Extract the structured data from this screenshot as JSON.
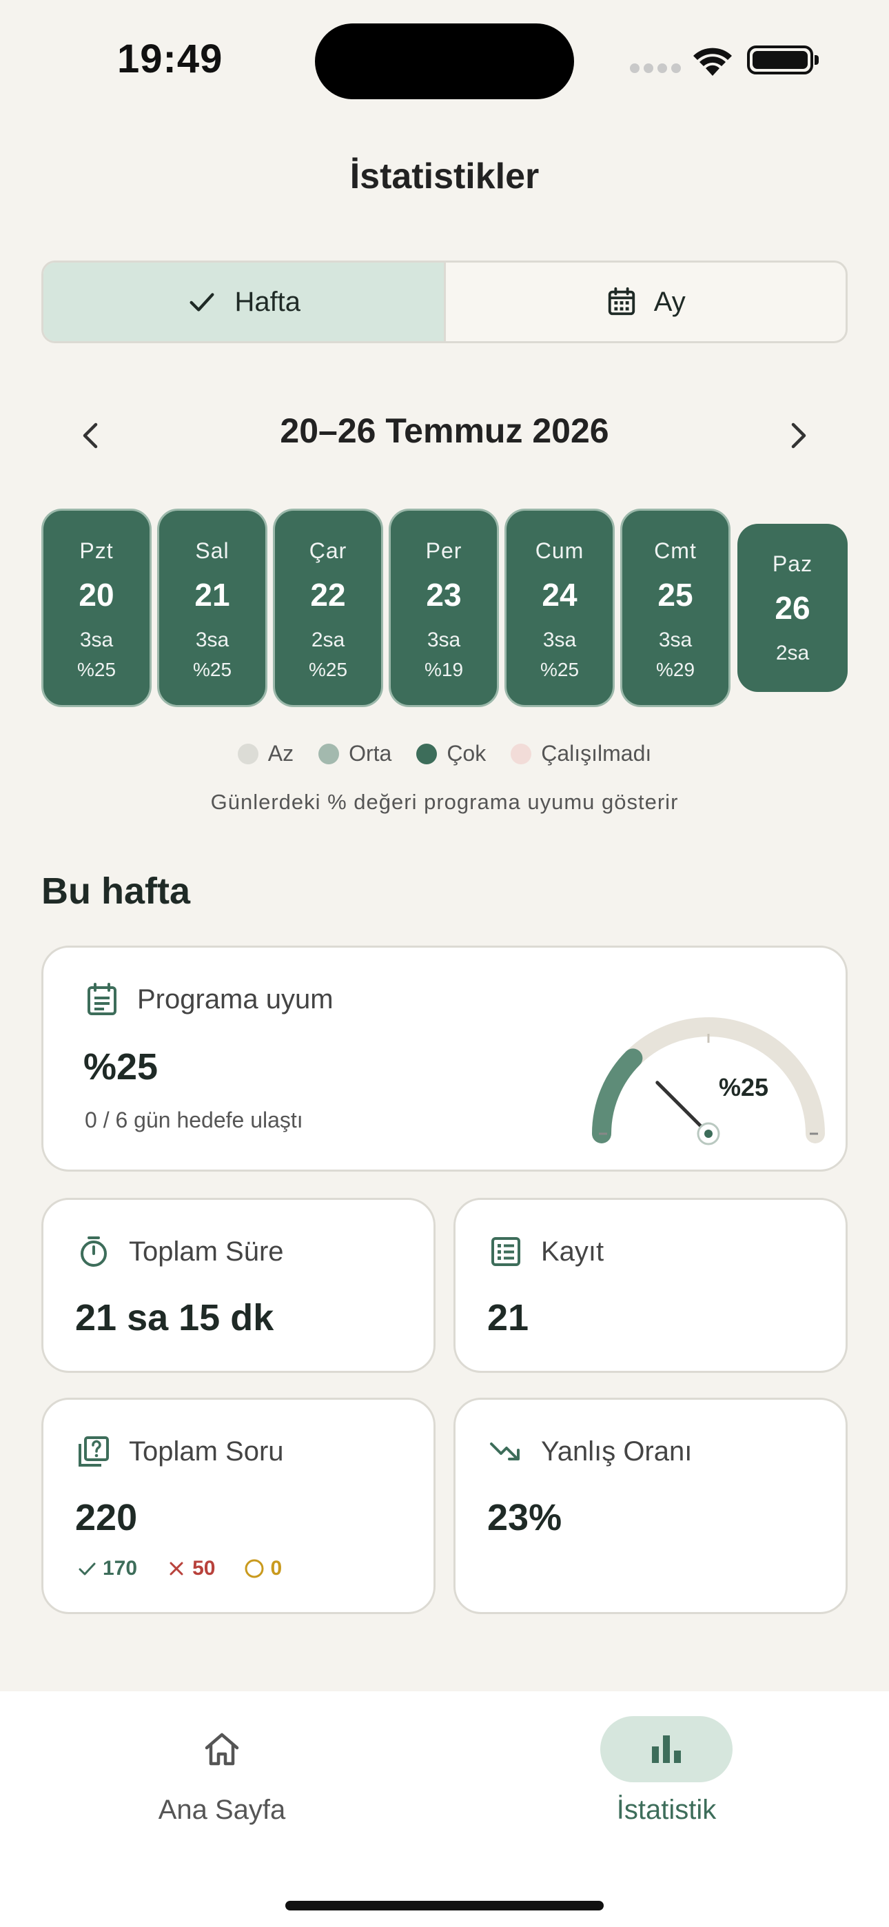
{
  "status_bar": {
    "time": "19:49"
  },
  "header": {
    "title": "İstatistikler"
  },
  "segment": {
    "week_label": "Hafta",
    "month_label": "Ay"
  },
  "week_nav": {
    "range": "20–26 Temmuz 2026"
  },
  "days": [
    {
      "name": "Pzt",
      "date": "20",
      "hours": "3sa",
      "percent": "%25"
    },
    {
      "name": "Sal",
      "date": "21",
      "hours": "3sa",
      "percent": "%25"
    },
    {
      "name": "Çar",
      "date": "22",
      "hours": "2sa",
      "percent": "%25"
    },
    {
      "name": "Per",
      "date": "23",
      "hours": "3sa",
      "percent": "%19"
    },
    {
      "name": "Cum",
      "date": "24",
      "hours": "3sa",
      "percent": "%25"
    },
    {
      "name": "Cmt",
      "date": "25",
      "hours": "3sa",
      "percent": "%29"
    },
    {
      "name": "Paz",
      "date": "26",
      "hours": "2sa"
    }
  ],
  "legend": {
    "items": [
      {
        "label": "Az",
        "color": "#DCDCD6"
      },
      {
        "label": "Orta",
        "color": "#A3B9AE"
      },
      {
        "label": "Çok",
        "color": "#3D6D5A"
      },
      {
        "label": "Çalışılmadı",
        "color": "#F2DCD8"
      }
    ],
    "note": "Günlerdeki % değeri programa uyumu gösterir"
  },
  "section": {
    "title": "Bu hafta"
  },
  "adherence": {
    "label": "Programa uyum",
    "value": "%25",
    "subtitle": "0 / 6 gün hedefe ulaştı",
    "gauge_label": "%25",
    "gauge_fraction": 0.25
  },
  "total_time": {
    "label": "Toplam Süre",
    "value": "21 sa 15 dk"
  },
  "records": {
    "label": "Kayıt",
    "value": "21"
  },
  "total_questions": {
    "label": "Toplam Soru",
    "value": "220",
    "correct": "170",
    "wrong": "50",
    "empty": "0"
  },
  "wrong_rate": {
    "label": "Yanlış Oranı",
    "value": "23%"
  },
  "colors": {
    "accent": "#3D6D5A",
    "accent_light": "#D6E6DD",
    "background": "#F5F3EE",
    "wrong": "#B8423C",
    "empty": "#C99A1E"
  },
  "tabbar": {
    "home_label": "Ana Sayfa",
    "stats_label": "İstatistik"
  }
}
